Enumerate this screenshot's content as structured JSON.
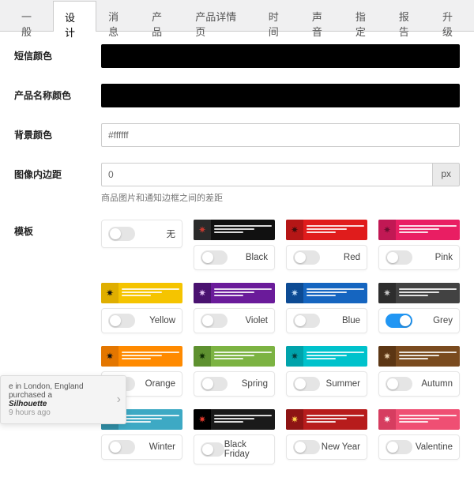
{
  "tabs": {
    "t0": "一般",
    "t1": "设计",
    "t2": "消息",
    "t3": "产品",
    "t4": "产品详情页",
    "t5": "时间",
    "t6": "声音",
    "t7": "指定",
    "t8": "报告",
    "t9": "升级"
  },
  "labels": {
    "smsColor": "短信颜色",
    "productNameColor": "产品名称颜色",
    "bgColor": "背景颜色",
    "imgPadding": "图像内边距",
    "template": "模板"
  },
  "fields": {
    "bgColorValue": "#ffffff",
    "imgPaddingValue": "0",
    "unitPx": "px",
    "imgPaddingHint": "商品图片和通知边框之间的差距"
  },
  "templates": {
    "none": {
      "label": "无"
    },
    "black": {
      "label": "Black",
      "bg": "#111111",
      "icon": "#2a2a2a",
      "bug": "#c63a2f"
    },
    "red": {
      "label": "Red",
      "bg": "#e01c1c",
      "icon": "#b51616",
      "bug": "#3a0d0d"
    },
    "pink": {
      "label": "Pink",
      "bg": "#e91e63",
      "icon": "#c11854",
      "bug": "#6b0e30"
    },
    "yellow": {
      "label": "Yellow",
      "bg": "#f5c400",
      "icon": "#dfae00",
      "bug": "#111111"
    },
    "violet": {
      "label": "Violet",
      "bg": "#6a1b9a",
      "icon": "#4a1270",
      "bug": "#e3c1f2"
    },
    "blue": {
      "label": "Blue",
      "bg": "#1565c0",
      "icon": "#0d4b94",
      "bug": "#bcd9f5"
    },
    "grey": {
      "label": "Grey",
      "bg": "#424242",
      "icon": "#2d2d2d",
      "bug": "#c9c9c9",
      "on": true
    },
    "orange": {
      "label": "Orange",
      "bg": "#ff8a00",
      "icon": "#e37600",
      "bug": "#111111"
    },
    "spring": {
      "label": "Spring",
      "bg": "#7cb342",
      "icon": "#5e9130",
      "bug": "#0d2c02"
    },
    "summer": {
      "label": "Summer",
      "bg": "#00c2cc",
      "icon": "#00a3ab",
      "bug": "#063b3d"
    },
    "autumn": {
      "label": "Autumn",
      "bg": "#7a4b1f",
      "icon": "#5c3614",
      "bug": "#e7cda9"
    },
    "winter": {
      "label": "Winter",
      "bg": "#3da9c4",
      "icon": "#2f8ca3",
      "bug": "#ffffff"
    },
    "blackfriday": {
      "label": "Black Friday",
      "bg": "#1a1a1a",
      "icon": "#000000",
      "bug": "#e63b2e"
    },
    "newyear": {
      "label": "New Year",
      "bg": "#b71c1c",
      "icon": "#8e1414",
      "bug": "#ffd24a"
    },
    "valentine": {
      "label": "Valentine",
      "bg": "#ef4f73",
      "icon": "#d63d60",
      "bug": "#ffffff"
    }
  },
  "toast": {
    "line1": "e in London, England purchased a",
    "line2": "Silhouette",
    "line3": "9 hours ago"
  }
}
